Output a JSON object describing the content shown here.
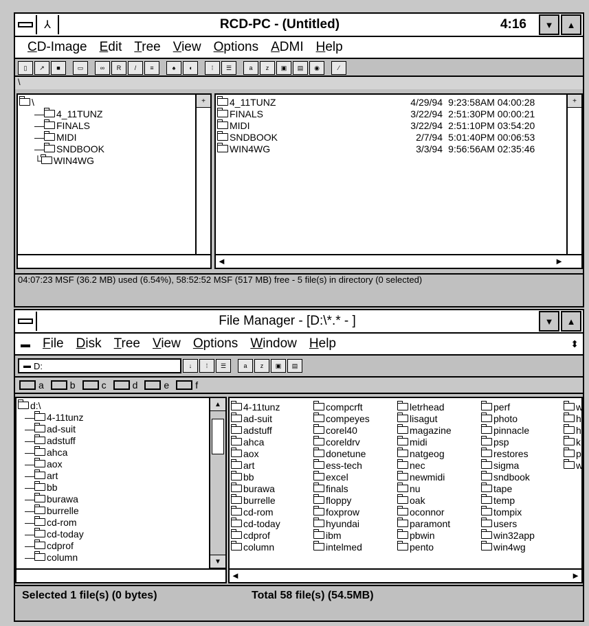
{
  "rcd": {
    "title": "RCD-PC - (Untitled)",
    "time": "4:16",
    "menu": [
      "CD-Image",
      "Edit",
      "Tree",
      "View",
      "Options",
      "ADMI",
      "Help"
    ],
    "path": "\\",
    "tree_root": "\\",
    "tree_items": [
      "4_11TUNZ",
      "FINALS",
      "MIDI",
      "SNDBOOK",
      "WIN4WG"
    ],
    "files": [
      {
        "name": "4_11TUNZ",
        "date": "4/29/94",
        "time": "9:23:58AM",
        "dur": "04:00:28"
      },
      {
        "name": "FINALS",
        "date": "3/22/94",
        "time": "2:51:30PM",
        "dur": "00:00:21"
      },
      {
        "name": "MIDI",
        "date": "3/22/94",
        "time": "2:51:10PM",
        "dur": "03:54:20"
      },
      {
        "name": "SNDBOOK",
        "date": "2/7/94",
        "time": "5:01:40PM",
        "dur": "00:06:53"
      },
      {
        "name": "WIN4WG",
        "date": "3/3/94",
        "time": "9:56:56AM",
        "dur": "02:35:46"
      }
    ],
    "status": "04:07:23 MSF (36.2 MB) used (6.54%), 58:52:52 MSF (517 MB) free - 5 file(s) in directory (0 selected)"
  },
  "fm": {
    "title": "File Manager - [D:\\*.* - ]",
    "menu": [
      "File",
      "Disk",
      "Tree",
      "View",
      "Options",
      "Window",
      "Help"
    ],
    "drive_select": "D:",
    "drives": [
      "a",
      "b",
      "c",
      "d",
      "e",
      "f"
    ],
    "tree_root": "d:\\",
    "tree_items": [
      "4-11tunz",
      "ad-suit",
      "adstuff",
      "ahca",
      "aox",
      "art",
      "bb",
      "burawa",
      "burrelle",
      "cd-rom",
      "cd-today",
      "cdprof",
      "column"
    ],
    "files_col1": [
      "4-11tunz",
      "ad-suit",
      "adstuff",
      "ahca",
      "aox",
      "art",
      "bb",
      "burawa",
      "burrelle",
      "cd-rom",
      "cd-today",
      "cdprof",
      "column"
    ],
    "files_col2": [
      "compcrft",
      "compeyes",
      "corel40",
      "coreldrv",
      "donetune",
      "ess-tech",
      "excel",
      "finals",
      "floppy",
      "foxprow",
      "hyundai",
      "ibm",
      "intelmed"
    ],
    "files_col3": [
      "letrhead",
      "lisagut",
      "magazine",
      "midi",
      "natgeog",
      "nec",
      "newmidi",
      "nu",
      "oak",
      "oconnor",
      "paramont",
      "pbwin",
      "pento"
    ],
    "files_col4": [
      "perf",
      "photo",
      "pinnacle",
      "psp",
      "restores",
      "sigma",
      "sndbook",
      "tape",
      "temp",
      "tompix",
      "users",
      "win32app",
      "win4wg"
    ],
    "files_col5": [
      "w",
      "h",
      "h",
      "k",
      "p",
      "w"
    ],
    "status_selected": "Selected 1 file(s) (0 bytes)",
    "status_total": "Total 58 file(s) (54.5MB)"
  }
}
